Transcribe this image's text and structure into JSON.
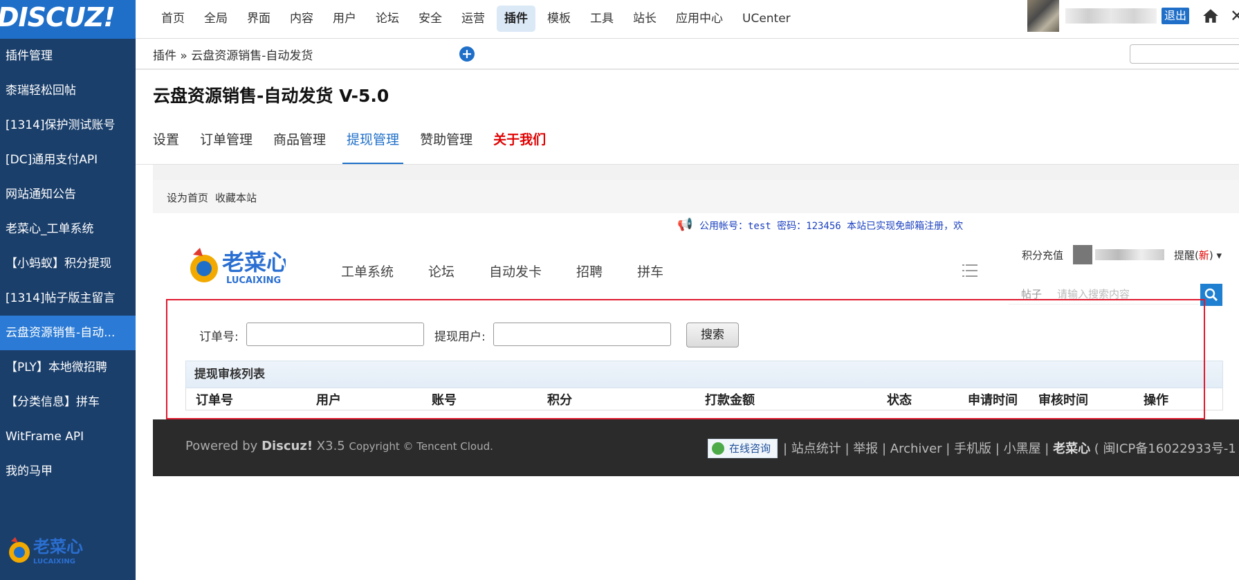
{
  "brand": {
    "logo_text": "DISCUZ!"
  },
  "top_nav": [
    "首页",
    "全局",
    "界面",
    "内容",
    "用户",
    "论坛",
    "安全",
    "运营",
    "插件",
    "模板",
    "工具",
    "站长",
    "应用中心",
    "UCenter"
  ],
  "top_nav_active": "插件",
  "user": {
    "logout_label": "退出"
  },
  "sidebar": {
    "items": [
      {
        "label": "插件管理"
      },
      {
        "label": "桼瑞轻松回帖"
      },
      {
        "label": "[1314]保护测试账号"
      },
      {
        "label": "[DC]通用支付API"
      },
      {
        "label": "网站通知公告"
      },
      {
        "label": "老菜心_工单系统"
      },
      {
        "label": "【小蚂蚁】积分提现"
      },
      {
        "label": "[1314]帖子版主留言"
      },
      {
        "label": "云盘资源销售-自动..."
      },
      {
        "label": "【PLY】本地微招聘"
      },
      {
        "label": "【分类信息】拼车"
      },
      {
        "label": "WitFrame API"
      },
      {
        "label": "我的马甲"
      }
    ],
    "active_index": 8
  },
  "breadcrumb": "插件 » 云盘资源销售-自动发货",
  "plugin": {
    "title": "云盘资源销售-自动发货 V-5.0",
    "tabs": [
      {
        "label": "设置"
      },
      {
        "label": "订单管理"
      },
      {
        "label": "商品管理"
      },
      {
        "label": "提现管理"
      },
      {
        "label": "赞助管理"
      },
      {
        "label": "关于我们"
      }
    ],
    "active_tab": "提现管理",
    "highlight_tab": "关于我们"
  },
  "site": {
    "quicklinks": [
      "设为首页",
      "收藏本站"
    ],
    "notice": "公用帐号：test 密码：123456 本站已实现免邮箱注册，欢",
    "nav": [
      "工单系统",
      "论坛",
      "自动发卡",
      "招聘",
      "拼车"
    ],
    "user_bar": {
      "recharge": "积分充值",
      "remind": "提醒",
      "remind_new": "新"
    },
    "search": {
      "category": "帖子",
      "placeholder": "请输入搜索内容"
    }
  },
  "form": {
    "order_label": "订单号:",
    "user_label": "提现用户:",
    "search_label": "搜索"
  },
  "list": {
    "title": "提现审核列表",
    "columns": [
      "订单号",
      "用户",
      "账号",
      "积分",
      "打款金额",
      "状态",
      "申请时间",
      "审核时间",
      "操作"
    ]
  },
  "footer": {
    "powered_prefix": "Powered by ",
    "powered_brand": "Discuz!",
    "powered_version": " X3.5 ",
    "copyright": "Copyright © Tencent Cloud.",
    "consult": "在线咨询",
    "links": " | 站点统计 | 举报 | Archiver | 手机版 | 小黑屋 | ",
    "brand": "老菜心",
    "icp": " ( 闽ICP备16022933号-1 )"
  },
  "colors": {
    "accent": "#1f6fc9",
    "sidebar_bg": "#1b3f6b",
    "highlight_red": "#e0192d"
  }
}
